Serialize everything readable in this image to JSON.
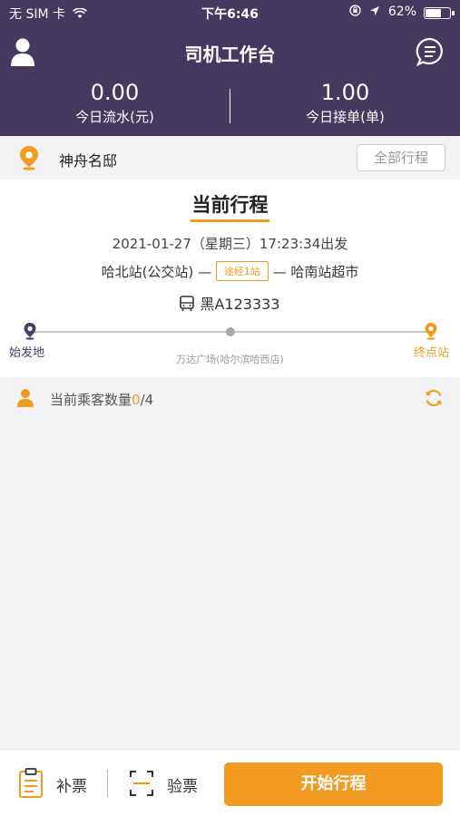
{
  "status_bar": {
    "carrier": "无 SIM 卡",
    "time": "下午6:46",
    "battery": "62%",
    "battery_level": 0.62
  },
  "nav": {
    "title": "司机工作台"
  },
  "stats": {
    "revenue": {
      "value": "0.00",
      "label": "今日流水(元)"
    },
    "orders": {
      "value": "1.00",
      "label": "今日接单(单)"
    }
  },
  "location": {
    "name": "神舟名邸",
    "all_trips_label": "全部行程"
  },
  "trip": {
    "title": "当前行程",
    "departure": "2021-01-27（星期三）17:23:34出发",
    "from": "哈北站(公交站)",
    "via": "途经1站",
    "to": "哈南站超市",
    "plate": "黑A123333",
    "start_label": "始发地",
    "end_label": "终点站",
    "mid_stop": "万达广场(哈尔滨哈西店)"
  },
  "passengers": {
    "label": "当前乘客数量",
    "current": "0",
    "capacity": "/4"
  },
  "bottom": {
    "supplement_label": "补票",
    "check_label": "验票",
    "start_label": "开始行程"
  },
  "colors": {
    "header": "#46395f",
    "accent": "#f29b21"
  },
  "icons": [
    "wifi-icon",
    "lock-rotation-icon",
    "location-arrow-icon",
    "battery-icon",
    "user-icon",
    "chat-icon",
    "location-pin-icon",
    "bus-icon",
    "passenger-icon",
    "refresh-icon",
    "clipboard-icon",
    "scan-icon"
  ]
}
